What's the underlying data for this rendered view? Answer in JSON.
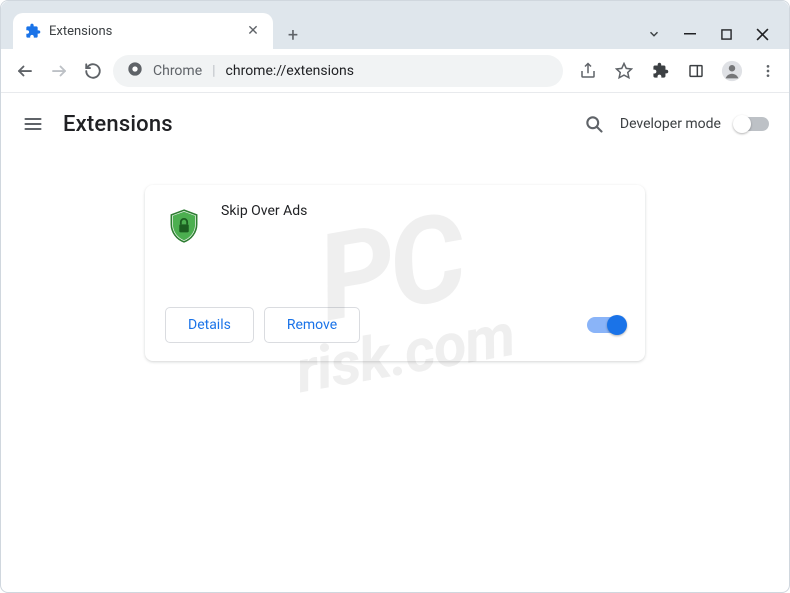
{
  "window": {
    "tab": {
      "title": "Extensions"
    }
  },
  "omnibox": {
    "chipLabel": "Chrome",
    "url": "chrome://extensions"
  },
  "page": {
    "title": "Extensions",
    "devModeLabel": "Developer mode"
  },
  "extension": {
    "name": "Skip Over Ads",
    "detailsLabel": "Details",
    "removeLabel": "Remove",
    "enabled": true
  },
  "watermark": {
    "line1": "PC",
    "line2": "risk.com"
  }
}
